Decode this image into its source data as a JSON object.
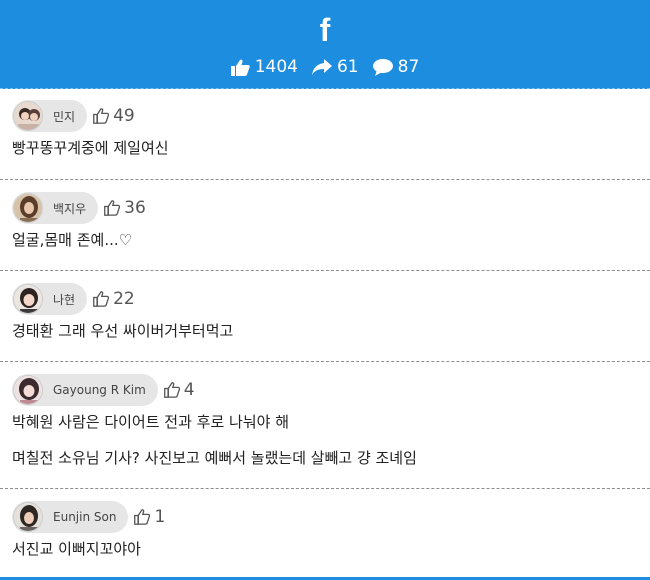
{
  "header": {
    "logo": "f",
    "likes": "1404",
    "shares": "61",
    "comments": "87",
    "color": "#1c8ddf"
  },
  "comments": [
    {
      "name": "민지",
      "likes": "49",
      "lines": [
        "빵꾸똥꾸계중에 제일여신"
      ],
      "avatar_icon": "person-photo-icon"
    },
    {
      "name": "백지우",
      "likes": "36",
      "lines": [
        "얼굴,몸매 존예...♡"
      ],
      "avatar_icon": "person-photo-icon"
    },
    {
      "name": "나현",
      "likes": "22",
      "lines": [
        "경태환 그래 우선 싸이버거부터먹고"
      ],
      "avatar_icon": "person-photo-icon"
    },
    {
      "name": "Gayoung R Kim",
      "likes": "4",
      "lines": [
        "박혜원 사람은 다이어트 전과 후로 나눠야 해",
        "며칠전 소유님 기사? 사진보고 예뻐서 놀랬는데 살빼고 걍 조녜임"
      ],
      "avatar_icon": "person-photo-icon"
    },
    {
      "name": "Eunjin Son",
      "likes": "1",
      "lines": [
        "서진교 이뻐지꼬야아"
      ],
      "avatar_icon": "person-photo-icon"
    }
  ]
}
